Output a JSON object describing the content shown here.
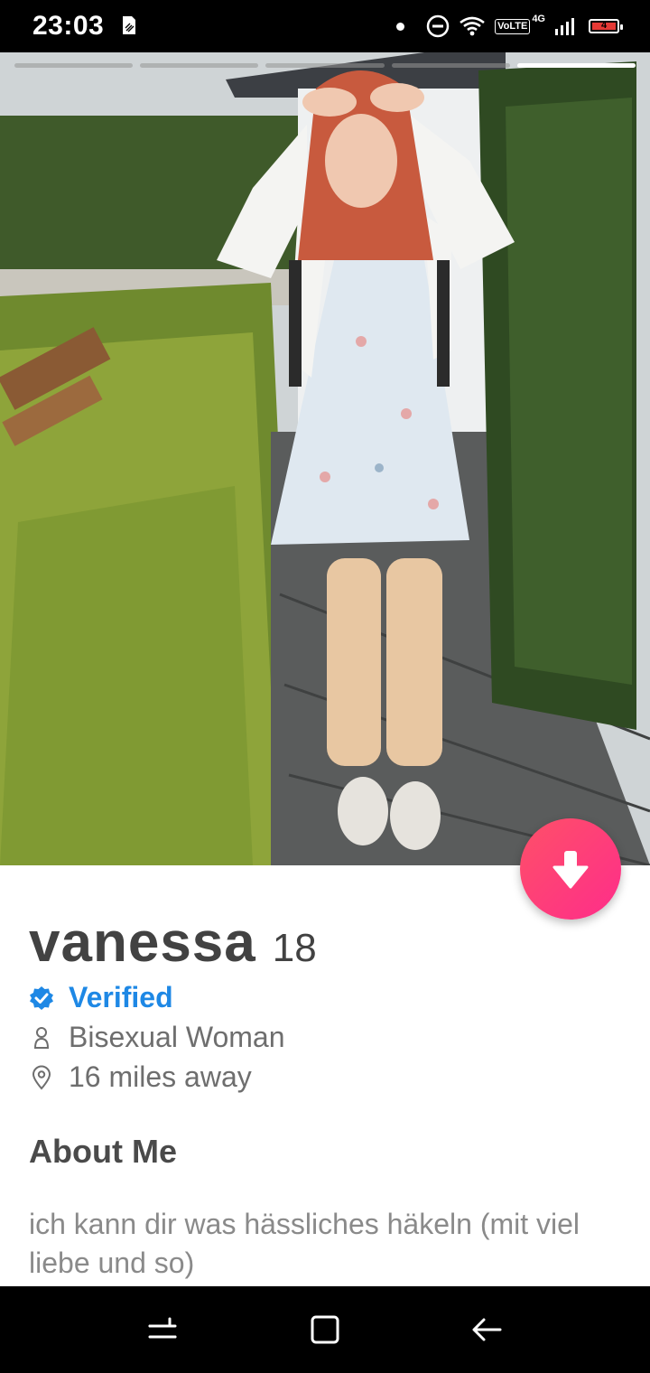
{
  "status_bar": {
    "time": "23:03",
    "volte": "VoLTE",
    "network": "4G",
    "battery": "4"
  },
  "photo": {
    "indicator_count": 5,
    "active_indicator": 5
  },
  "profile": {
    "name": "vanessa",
    "age": "18",
    "verified_label": "Verified",
    "orientation": "Bisexual Woman",
    "distance": "16 miles away"
  },
  "about": {
    "title": "About Me",
    "text": "ich kann dir was hässliches häkeln (mit viel liebe und so)"
  },
  "icons": {
    "verified": "verified-badge-icon",
    "gender": "person-icon",
    "distance": "location-pin-icon",
    "expand": "arrow-down-icon"
  },
  "colors": {
    "accent_gradient_start": "#fd5068",
    "accent_gradient_end": "#ff2d8a",
    "verified": "#1e88e5",
    "text_dark": "#424242",
    "text_muted": "#8a8a8a"
  }
}
